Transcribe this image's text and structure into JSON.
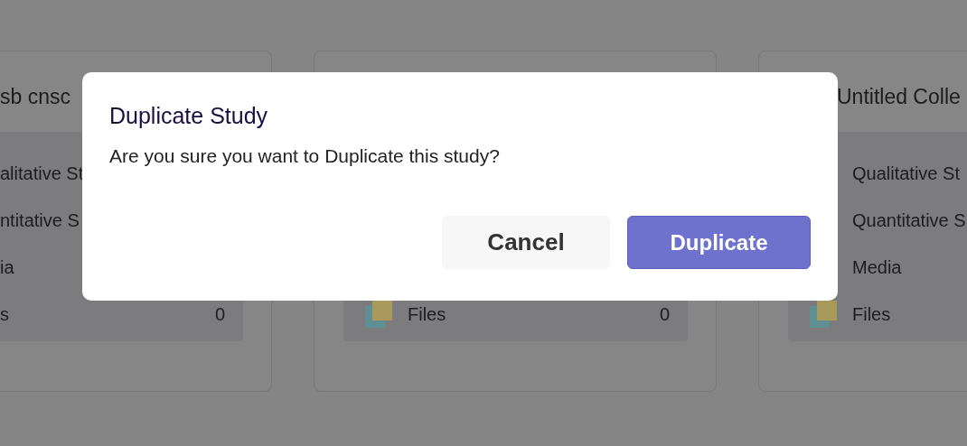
{
  "cards": [
    {
      "title": "sb cnsc",
      "rows": [
        {
          "kind": "plain",
          "label": "alitative St"
        },
        {
          "kind": "plain",
          "label": "ntitative S"
        },
        {
          "kind": "plain",
          "label": "ia"
        },
        {
          "kind": "plain",
          "label": "s",
          "count": "0"
        }
      ]
    },
    {
      "rows": [
        {
          "kind": "files",
          "label": "Files",
          "count": "0"
        }
      ]
    },
    {
      "title": "Untitled Colle",
      "rows": [
        {
          "kind": "plain",
          "label": "Qualitative St"
        },
        {
          "kind": "plain",
          "label": "Quantitative S"
        },
        {
          "kind": "plain",
          "label": "Media"
        },
        {
          "kind": "files",
          "label": "Files"
        }
      ]
    }
  ],
  "dialog": {
    "title": "Duplicate Study",
    "message": "Are you sure you want to Duplicate this study?",
    "buttons": [
      {
        "kind": "secondary",
        "label": "Cancel"
      },
      {
        "kind": "primary",
        "label": "Duplicate"
      }
    ]
  }
}
